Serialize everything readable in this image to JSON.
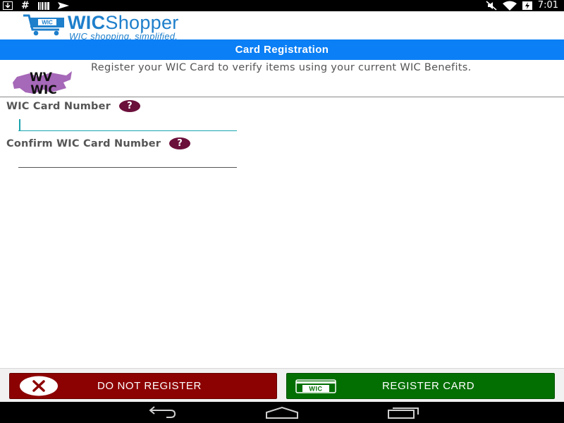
{
  "status_bar": {
    "time": "7:01",
    "left_icons": [
      "download-icon",
      "hash-icon",
      "barcode-icon",
      "send-icon"
    ],
    "right_icons": [
      "mute-icon",
      "wifi-icon",
      "battery-charging-icon"
    ],
    "hash_glyph": "#"
  },
  "header": {
    "logo_bold": "WIC",
    "logo_rest": "Shopper",
    "tagline": "WIC shopping, simplified.",
    "cart_label": "WIC"
  },
  "title_bar": {
    "title": "Card Registration"
  },
  "info": {
    "logo_line1": "WV",
    "logo_line2": "WIC",
    "text": "Register your WIC Card to verify items using your current WIC Benefits."
  },
  "form": {
    "card_number": {
      "label": "WIC Card Number",
      "help": "?",
      "value": "",
      "placeholder": ""
    },
    "confirm_card_number": {
      "label": "Confirm WIC Card Number",
      "help": "?",
      "value": "",
      "placeholder": ""
    }
  },
  "buttons": {
    "do_not_register": "DO NOT REGISTER",
    "register_card": "REGISTER CARD",
    "card_icon_label": "WIC"
  },
  "colors": {
    "accent_blue": "#0b7ff5",
    "brand_blue": "#1e7fcb",
    "help_icon": "#6b0f3b",
    "decline_red": "#8c0202",
    "confirm_green": "#036f03"
  }
}
